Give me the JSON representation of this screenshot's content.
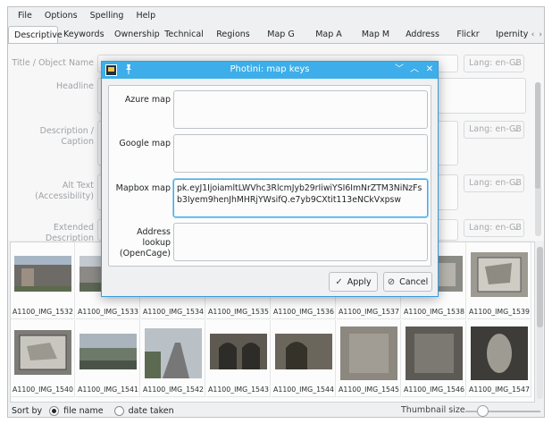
{
  "menubar": {
    "items": [
      "File",
      "Options",
      "Spelling",
      "Help"
    ]
  },
  "tabs": [
    "Descriptive",
    "Keywords",
    "Ownership",
    "Technical",
    "Regions",
    "Map G",
    "Map A",
    "Map M",
    "Address",
    "Flickr",
    "Ipernity"
  ],
  "tab_arrows": {
    "left": "‹",
    "right": "›"
  },
  "form": {
    "fields": [
      {
        "label": "Title / Object Name",
        "lang": "Lang: en-GB"
      },
      {
        "label": "Headline",
        "lang": ""
      },
      {
        "label": "Description / Caption",
        "lang": "Lang: en-GB"
      },
      {
        "label": "Alt Text\n(Accessibility)",
        "lang": "Lang: en-GB"
      },
      {
        "label": "Extended Description\n(Accessibility)",
        "lang": "Lang: en-GB"
      }
    ]
  },
  "thumbnails": [
    "A1100_IMG_1532",
    "A1100_IMG_1533",
    "A1100_IMG_1534",
    "A1100_IMG_1535",
    "A1100_IMG_1536",
    "A1100_IMG_1537",
    "A1100_IMG_1538",
    "A1100_IMG_1539",
    "A1100_IMG_1540",
    "A1100_IMG_1541",
    "A1100_IMG_1542",
    "A1100_IMG_1543",
    "A1100_IMG_1544",
    "A1100_IMG_1545",
    "A1100_IMG_1546",
    "A1100_IMG_1547"
  ],
  "bottom": {
    "sort_label": "Sort by",
    "opt_filename": "file name",
    "opt_date": "date taken",
    "size_label": "Thumbnail size",
    "selected_sort": "file name"
  },
  "dialog": {
    "title": "Photini: map keys",
    "title_icons": {
      "minimize": "﹀",
      "maximize": "︿",
      "close": "✕"
    },
    "fields": [
      {
        "label": "Azure map",
        "value": ""
      },
      {
        "label": "Google map",
        "value": ""
      },
      {
        "label": "Mapbox map",
        "value": "pk.eyJ1IjoiamltLWVhc3RlcmJyb29rIiwiYSI6ImNrZTM3NiNzFsb3Iyem9henJhMHRjYWsifQ.e7yb9CXtit113eNCkVxpsw"
      },
      {
        "label": "Address lookup\n(OpenCage)",
        "value": ""
      }
    ],
    "apply_label": "Apply",
    "cancel_label": "Cancel"
  },
  "colors": {
    "accent": "#3daee9",
    "window_bg": "#eff0f1",
    "dimmed_text": "#9fa2a4"
  },
  "icons": [
    "app-icon",
    "pin-icon",
    "minimize-icon",
    "maximize-icon",
    "close-icon",
    "checkmark-icon",
    "cancel-icon",
    "chevron-down-icon"
  ]
}
